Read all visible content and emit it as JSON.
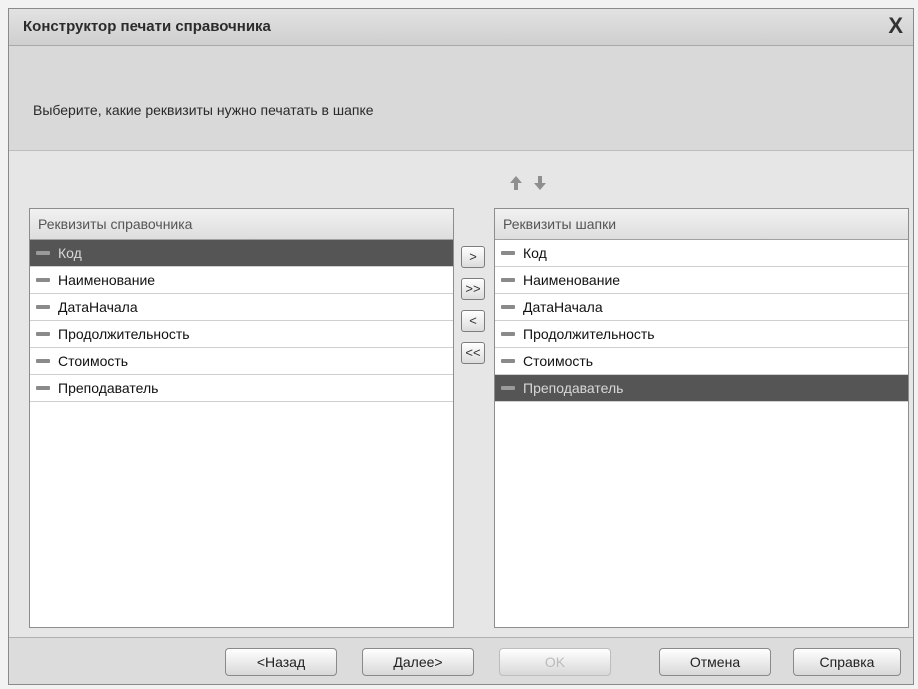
{
  "window": {
    "title": "Конструктор печати справочника",
    "close_glyph": "X"
  },
  "instruction": "Выберите, какие реквизиты нужно печатать в шапке",
  "icons": [
    "arrow-up-icon",
    "arrow-down-icon"
  ],
  "left_panel": {
    "header": "Реквизиты справочника",
    "items": [
      {
        "label": "Код",
        "selected": true
      },
      {
        "label": "Наименование",
        "selected": false
      },
      {
        "label": "ДатаНачала",
        "selected": false
      },
      {
        "label": "Продолжительность",
        "selected": false
      },
      {
        "label": "Стоимость",
        "selected": false
      },
      {
        "label": "Преподаватель",
        "selected": false
      }
    ]
  },
  "transfer_buttons": [
    ">",
    ">>",
    "<",
    "<<"
  ],
  "right_panel": {
    "header": "Реквизиты шапки",
    "items": [
      {
        "label": "Код",
        "selected": false
      },
      {
        "label": "Наименование",
        "selected": false
      },
      {
        "label": "ДатаНачала",
        "selected": false
      },
      {
        "label": "Продолжительность",
        "selected": false
      },
      {
        "label": "Стоимость",
        "selected": false
      },
      {
        "label": "Преподаватель",
        "selected": true
      }
    ]
  },
  "footer": {
    "back": "<Назад",
    "next": "Далее>",
    "ok": "OK",
    "cancel": "Отмена",
    "help": "Справка"
  }
}
